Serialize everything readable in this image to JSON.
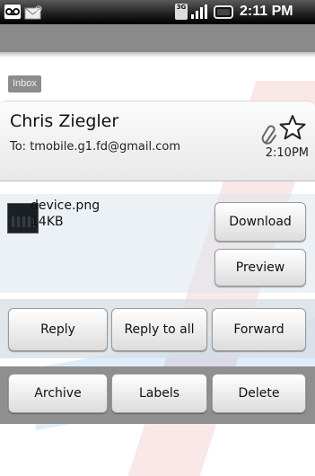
{
  "status_bar": {
    "time": "2:11 PM",
    "network": "3G",
    "icons": [
      "voicemail-icon",
      "new-mail-icon",
      "3g-icon",
      "signal-icon",
      "battery-icon"
    ]
  },
  "message": {
    "label": "Inbox",
    "sender": "Chris Ziegler",
    "recipient": "To: tmobile.g1.fd@gmail.com",
    "time": "2:10PM",
    "starred": false,
    "has_attachment": true
  },
  "attachment": {
    "name": "device.png",
    "size": "14KB",
    "download_label": "Download",
    "preview_label": "Preview"
  },
  "actions": {
    "reply": "Reply",
    "reply_all": "Reply to all",
    "forward": "Forward",
    "archive": "Archive",
    "labels": "Labels",
    "delete": "Delete"
  },
  "colors": {
    "status_bar": "#000000",
    "title_bar": "#8a8a8a",
    "label_chip": "#8c8c8c",
    "action_bar": "#8f8f8f"
  }
}
